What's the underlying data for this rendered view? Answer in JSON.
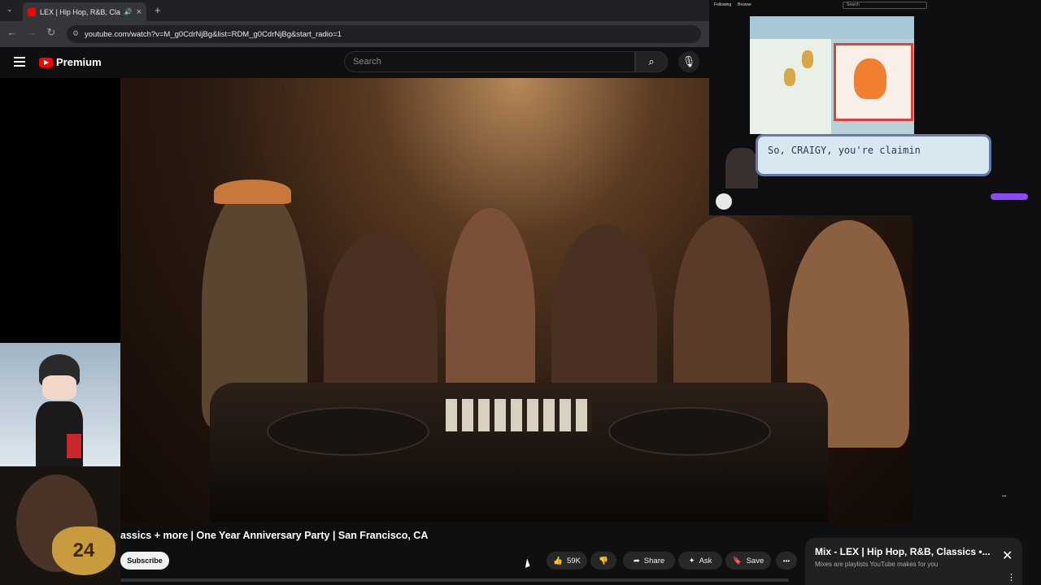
{
  "browser": {
    "tab_title": "LEX | Hip Hop, R&B, Classic",
    "tab_close": "×",
    "new_tab": "+",
    "url": "youtube.com/watch?v=M_g0CdrNjBg&list=RDM_g0CdrNjBg&start_radio=1"
  },
  "youtube": {
    "logo_text": "Premium",
    "search_placeholder": "Search"
  },
  "stream": {
    "top_items": [
      "Following",
      "Browse"
    ],
    "search_placeholder": "Search",
    "dialog_text": "So, CRAIGY, you're claimin"
  },
  "video": {
    "title": "assics + more | One Year Anniversary Party | San Francisco, CA",
    "subscribe_label": "Subscribe",
    "likes": "59K",
    "share_label": "Share",
    "ask_label": "Ask",
    "save_label": "Save",
    "more_label": "•••"
  },
  "mix_panel": {
    "title": "Mix - LEX | Hip Hop, R&B, Classics •...",
    "subtitle": "Mixes are playlists YouTube makes for you",
    "close": "✕",
    "menu": "⋮"
  },
  "overlay": {
    "badge": "24"
  },
  "colors": {
    "youtube_red": "#ff0000",
    "background": "#0f0f0f",
    "pill": "#272727"
  }
}
